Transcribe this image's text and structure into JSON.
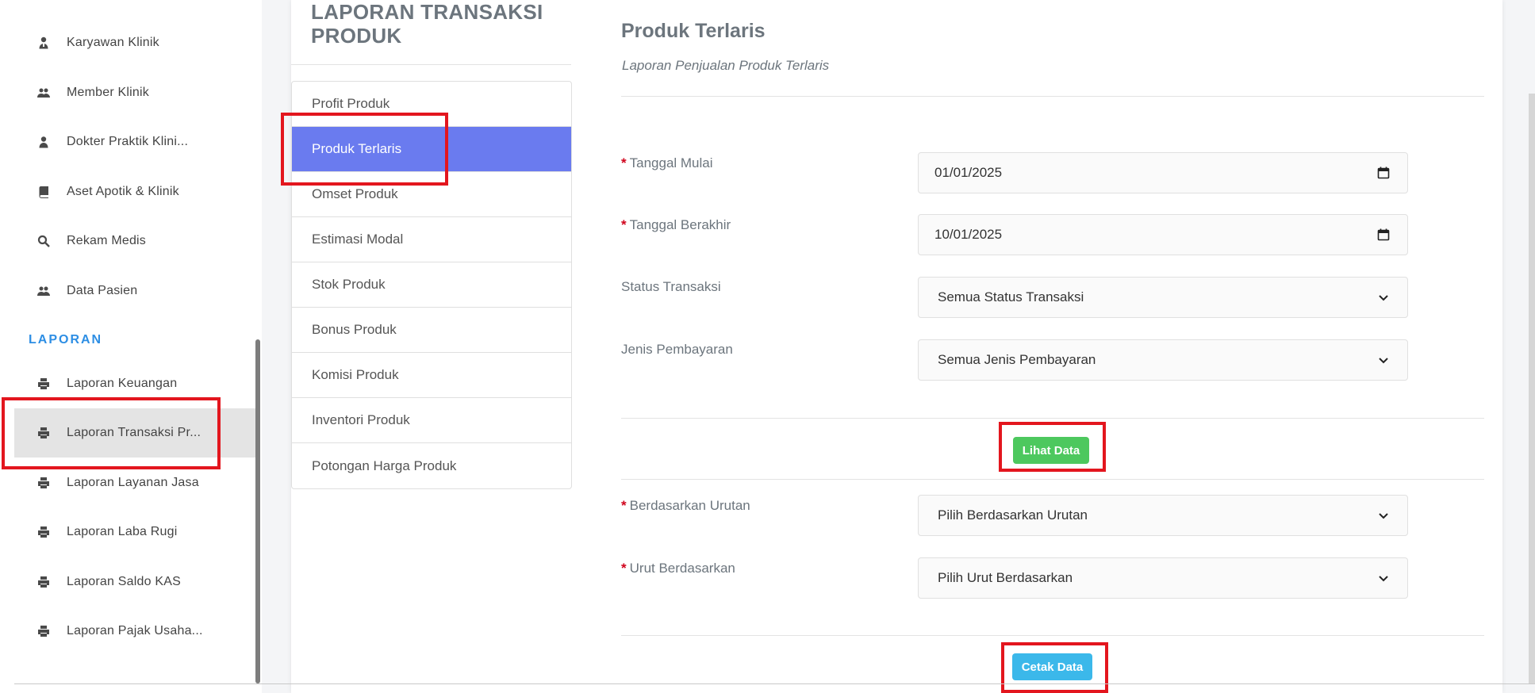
{
  "sidebar": {
    "items": [
      {
        "label": "Karyawan Klinik",
        "icon": "user-tie-icon"
      },
      {
        "label": "Member Klinik",
        "icon": "users-icon"
      },
      {
        "label": "Dokter Praktik Klini...",
        "icon": "user-icon"
      },
      {
        "label": "Aset Apotik & Klinik",
        "icon": "book-icon"
      },
      {
        "label": "Rekam Medis",
        "icon": "search-icon"
      },
      {
        "label": "Data Pasien",
        "icon": "users-icon"
      }
    ],
    "section_label": "LAPORAN",
    "report_items": [
      {
        "label": "Laporan Keuangan",
        "icon": "printer-icon"
      },
      {
        "label": "Laporan Transaksi Pr...",
        "icon": "printer-icon",
        "active": true
      },
      {
        "label": "Laporan Layanan Jasa",
        "icon": "printer-icon"
      },
      {
        "label": "Laporan Laba Rugi",
        "icon": "printer-icon"
      },
      {
        "label": "Laporan Saldo KAS",
        "icon": "printer-icon"
      },
      {
        "label": "Laporan Pajak Usaha...",
        "icon": "printer-icon"
      }
    ]
  },
  "page_title": "LAPORAN TRANSAKSI PRODUK",
  "menu": {
    "items": [
      "Profit Produk",
      "Produk Terlaris",
      "Omset Produk",
      "Estimasi Modal",
      "Stok Produk",
      "Bonus Produk",
      "Komisi Produk",
      "Inventori Produk",
      "Potongan Harga Produk"
    ],
    "active": "Produk Terlaris"
  },
  "section": {
    "title": "Produk Terlaris",
    "subtitle": "Laporan Penjualan Produk Terlaris"
  },
  "form": {
    "tanggal_mulai": {
      "label": "Tanggal Mulai",
      "value": "01/01/2025",
      "required": "*"
    },
    "tanggal_berakhir": {
      "label": "Tanggal Berakhir",
      "value": "10/01/2025",
      "required": "*"
    },
    "status_transaksi": {
      "label": "Status Transaksi",
      "value": "Semua Status Transaksi"
    },
    "jenis_pembayaran": {
      "label": "Jenis Pembayaran",
      "value": "Semua Jenis Pembayaran"
    },
    "lihat_data_label": "Lihat Data",
    "berdasarkan_urutan": {
      "label": "Berdasarkan Urutan",
      "value": "Pilih Berdasarkan Urutan",
      "required": "*"
    },
    "urut_berdasarkan": {
      "label": "Urut Berdasarkan",
      "value": "Pilih Urut Berdasarkan",
      "required": "*"
    },
    "cetak_data_label": "Cetak Data"
  },
  "colors": {
    "accent_active": "#6a7bef",
    "button_green": "#4dc85e",
    "button_blue": "#3bb8ea",
    "section_label": "#2d8ee4",
    "highlight_box": "#e3161e"
  }
}
